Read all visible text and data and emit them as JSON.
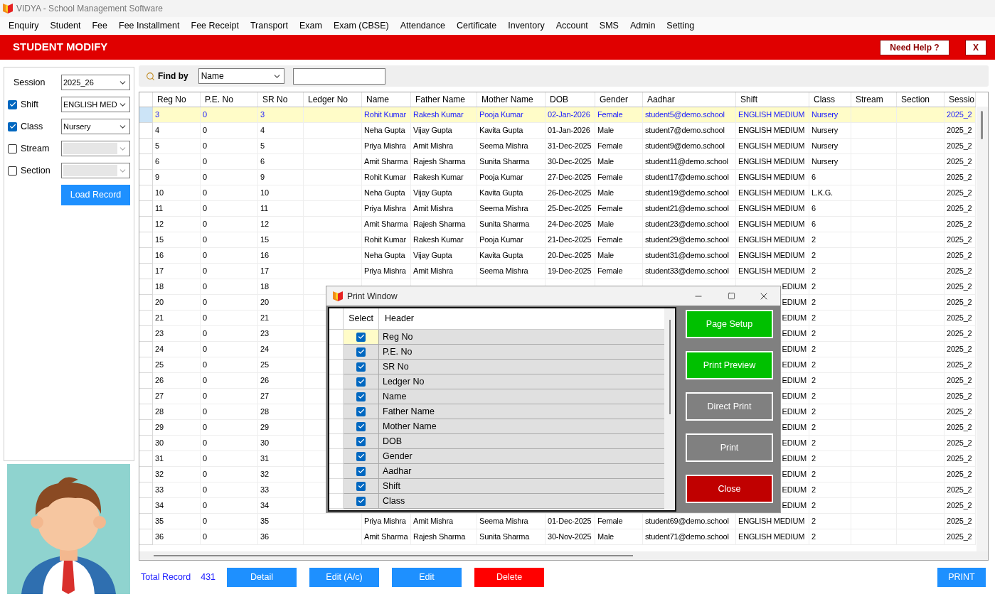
{
  "window": {
    "title": "VIDYA - School Management Software"
  },
  "menu": [
    "Enquiry",
    "Student",
    "Fee",
    "Fee Installment",
    "Fee Receipt",
    "Transport",
    "Exam",
    "Exam (CBSE)",
    "Attendance",
    "Certificate",
    "Inventory",
    "Account",
    "SMS",
    "Admin",
    "Setting"
  ],
  "header": {
    "title": "STUDENT MODIFY",
    "help_button": "Need Help ?",
    "close_button": "X"
  },
  "filters": [
    {
      "kind": "plain",
      "label": "Session",
      "value": "2025_26",
      "disabled": false
    },
    {
      "kind": "checkbox",
      "label": "Shift",
      "checked": true,
      "value": "ENGLISH MED",
      "disabled": false
    },
    {
      "kind": "checkbox",
      "label": "Class",
      "checked": true,
      "value": "Nursery",
      "disabled": false
    },
    {
      "kind": "checkbox",
      "label": "Stream",
      "checked": false,
      "disabled": true
    },
    {
      "kind": "checkbox",
      "label": "Section",
      "checked": false,
      "disabled": true
    }
  ],
  "load_button": "Load Record",
  "find": {
    "label": "Find by",
    "field": "Name"
  },
  "table": {
    "columns": [
      "Reg No",
      "P.E. No",
      "SR No",
      "Ledger No",
      "Name",
      "Father Name",
      "Mother Name",
      "DOB",
      "Gender",
      "Aadhar",
      "Shift",
      "Class",
      "Stream",
      "Section",
      "Sessio"
    ],
    "rows": [
      {
        "kind": "full",
        "selected": true,
        "reg_no": "3",
        "pe_no": "0",
        "sr_no": "3",
        "name": "Rohit Kumar",
        "father_name": "Rakesh Kumar",
        "mother_name": "Pooja Kumar",
        "dob": "02-Jan-2026",
        "gender": "Female",
        "aadhar": "student5@demo.school",
        "shift": "ENGLISH MEDIUM",
        "class": "Nursery",
        "session": "2025_2"
      },
      {
        "kind": "full",
        "selected": false,
        "reg_no": "4",
        "pe_no": "0",
        "sr_no": "4",
        "name": "Neha Gupta",
        "father_name": "Vijay Gupta",
        "mother_name": "Kavita Gupta",
        "dob": "01-Jan-2026",
        "gender": "Male",
        "aadhar": "student7@demo.school",
        "shift": "ENGLISH MEDIUM",
        "class": "Nursery",
        "session": "2025_2"
      },
      {
        "kind": "full",
        "selected": false,
        "reg_no": "5",
        "pe_no": "0",
        "sr_no": "5",
        "name": "Priya Mishra",
        "father_name": "Amit Mishra",
        "mother_name": "Seema Mishra",
        "dob": "31-Dec-2025",
        "gender": "Female",
        "aadhar": "student9@demo.school",
        "shift": "ENGLISH MEDIUM",
        "class": "Nursery",
        "session": "2025_2"
      },
      {
        "kind": "full",
        "selected": false,
        "reg_no": "6",
        "pe_no": "0",
        "sr_no": "6",
        "name": "Amit Sharma",
        "father_name": "Rajesh Sharma",
        "mother_name": "Sunita Sharma",
        "dob": "30-Dec-2025",
        "gender": "Male",
        "aadhar": "student11@demo.school",
        "shift": "ENGLISH MEDIUM",
        "class": "Nursery",
        "session": "2025_2"
      },
      {
        "kind": "full",
        "selected": false,
        "reg_no": "9",
        "pe_no": "0",
        "sr_no": "9",
        "name": "Rohit Kumar",
        "father_name": "Rakesh Kumar",
        "mother_name": "Pooja Kumar",
        "dob": "27-Dec-2025",
        "gender": "Female",
        "aadhar": "student17@demo.school",
        "shift": "ENGLISH MEDIUM",
        "class": "6",
        "session": "2025_2"
      },
      {
        "kind": "full",
        "selected": false,
        "reg_no": "10",
        "pe_no": "0",
        "sr_no": "10",
        "name": "Neha Gupta",
        "father_name": "Vijay Gupta",
        "mother_name": "Kavita Gupta",
        "dob": "26-Dec-2025",
        "gender": "Male",
        "aadhar": "student19@demo.school",
        "shift": "ENGLISH MEDIUM",
        "class": "L.K.G.",
        "session": "2025_2"
      },
      {
        "kind": "full",
        "selected": false,
        "reg_no": "11",
        "pe_no": "0",
        "sr_no": "11",
        "name": "Priya Mishra",
        "father_name": "Amit Mishra",
        "mother_name": "Seema Mishra",
        "dob": "25-Dec-2025",
        "gender": "Female",
        "aadhar": "student21@demo.school",
        "shift": "ENGLISH MEDIUM",
        "class": "6",
        "session": "2025_2"
      },
      {
        "kind": "full",
        "selected": false,
        "reg_no": "12",
        "pe_no": "0",
        "sr_no": "12",
        "name": "Amit Sharma",
        "father_name": "Rajesh Sharma",
        "mother_name": "Sunita Sharma",
        "dob": "24-Dec-2025",
        "gender": "Male",
        "aadhar": "student23@demo.school",
        "shift": "ENGLISH MEDIUM",
        "class": "6",
        "session": "2025_2"
      },
      {
        "kind": "full",
        "selected": false,
        "reg_no": "15",
        "pe_no": "0",
        "sr_no": "15",
        "name": "Rohit Kumar",
        "father_name": "Rakesh Kumar",
        "mother_name": "Pooja Kumar",
        "dob": "21-Dec-2025",
        "gender": "Female",
        "aadhar": "student29@demo.school",
        "shift": "ENGLISH MEDIUM",
        "class": "2",
        "session": "2025_2"
      },
      {
        "kind": "full",
        "selected": false,
        "reg_no": "16",
        "pe_no": "0",
        "sr_no": "16",
        "name": "Neha Gupta",
        "father_name": "Vijay Gupta",
        "mother_name": "Kavita Gupta",
        "dob": "20-Dec-2025",
        "gender": "Male",
        "aadhar": "student31@demo.school",
        "shift": "ENGLISH MEDIUM",
        "class": "2",
        "session": "2025_2"
      },
      {
        "kind": "full",
        "selected": false,
        "reg_no": "17",
        "pe_no": "0",
        "sr_no": "17",
        "name": "Priya Mishra",
        "father_name": "Amit Mishra",
        "mother_name": "Seema Mishra",
        "dob": "19-Dec-2025",
        "gender": "Female",
        "aadhar": "student33@demo.school",
        "shift": "ENGLISH MEDIUM",
        "class": "2",
        "session": "2025_2"
      },
      {
        "kind": "behind-dialog",
        "selected": false,
        "reg_no": "18",
        "pe_no": "0",
        "sr_no": "18",
        "shift": "EDIUM",
        "class": "2",
        "session": "2025_2"
      },
      {
        "kind": "behind-dialog",
        "selected": false,
        "reg_no": "20",
        "pe_no": "0",
        "sr_no": "20",
        "shift": "EDIUM",
        "class": "2",
        "session": "2025_2"
      },
      {
        "kind": "behind-dialog",
        "selected": false,
        "reg_no": "21",
        "pe_no": "0",
        "sr_no": "21",
        "shift": "EDIUM",
        "class": "2",
        "session": "2025_2"
      },
      {
        "kind": "behind-dialog",
        "selected": false,
        "reg_no": "23",
        "pe_no": "0",
        "sr_no": "23",
        "shift": "EDIUM",
        "class": "2",
        "session": "2025_2"
      },
      {
        "kind": "behind-dialog",
        "selected": false,
        "reg_no": "24",
        "pe_no": "0",
        "sr_no": "24",
        "shift": "EDIUM",
        "class": "2",
        "session": "2025_2"
      },
      {
        "kind": "behind-dialog",
        "selected": false,
        "reg_no": "25",
        "pe_no": "0",
        "sr_no": "25",
        "shift": "EDIUM",
        "class": "2",
        "session": "2025_2"
      },
      {
        "kind": "behind-dialog",
        "selected": false,
        "reg_no": "26",
        "pe_no": "0",
        "sr_no": "26",
        "shift": "EDIUM",
        "class": "2",
        "session": "2025_2"
      },
      {
        "kind": "behind-dialog",
        "selected": false,
        "reg_no": "27",
        "pe_no": "0",
        "sr_no": "27",
        "shift": "EDIUM",
        "class": "2",
        "session": "2025_2"
      },
      {
        "kind": "behind-dialog",
        "selected": false,
        "reg_no": "28",
        "pe_no": "0",
        "sr_no": "28",
        "shift": "EDIUM",
        "class": "2",
        "session": "2025_2"
      },
      {
        "kind": "behind-dialog",
        "selected": false,
        "reg_no": "29",
        "pe_no": "0",
        "sr_no": "29",
        "shift": "EDIUM",
        "class": "2",
        "session": "2025_2"
      },
      {
        "kind": "behind-dialog",
        "selected": false,
        "reg_no": "30",
        "pe_no": "0",
        "sr_no": "30",
        "shift": "EDIUM",
        "class": "2",
        "session": "2025_2"
      },
      {
        "kind": "behind-dialog",
        "selected": false,
        "reg_no": "31",
        "pe_no": "0",
        "sr_no": "31",
        "shift": "EDIUM",
        "class": "2",
        "session": "2025_2"
      },
      {
        "kind": "behind-dialog",
        "selected": false,
        "reg_no": "32",
        "pe_no": "0",
        "sr_no": "32",
        "shift": "EDIUM",
        "class": "2",
        "session": "2025_2"
      },
      {
        "kind": "behind-dialog",
        "selected": false,
        "reg_no": "33",
        "pe_no": "0",
        "sr_no": "33",
        "shift": "EDIUM",
        "class": "2",
        "session": "2025_2"
      },
      {
        "kind": "behind-dialog",
        "selected": false,
        "reg_no": "34",
        "pe_no": "0",
        "sr_no": "34",
        "shift": "EDIUM",
        "class": "2",
        "session": "2025_2"
      },
      {
        "kind": "full",
        "selected": false,
        "reg_no": "35",
        "pe_no": "0",
        "sr_no": "35",
        "name": "Priya Mishra",
        "father_name": "Amit Mishra",
        "mother_name": "Seema Mishra",
        "dob": "01-Dec-2025",
        "gender": "Female",
        "aadhar": "student69@demo.school",
        "shift": "ENGLISH MEDIUM",
        "class": "2",
        "session": "2025_2"
      },
      {
        "kind": "full",
        "selected": false,
        "reg_no": "36",
        "pe_no": "0",
        "sr_no": "36",
        "name": "Amit Sharma",
        "father_name": "Rajesh Sharma",
        "mother_name": "Sunita Sharma",
        "dob": "30-Nov-2025",
        "gender": "Male",
        "aadhar": "student71@demo.school",
        "shift": "ENGLISH MEDIUM",
        "class": "2",
        "session": "2025_2"
      }
    ]
  },
  "footer": {
    "total_label": "Total Record",
    "total": "431",
    "buttons": [
      {
        "label": "Detail",
        "kind": "primary"
      },
      {
        "label": "Edit (A/c)",
        "kind": "primary"
      },
      {
        "label": "Edit",
        "kind": "primary"
      },
      {
        "label": "Delete",
        "kind": "danger"
      }
    ],
    "print_button": "PRINT"
  },
  "print_window": {
    "title": "Print Window",
    "columns": [
      "Select",
      "Header"
    ],
    "rows": [
      {
        "header": "Reg No",
        "checked": true,
        "selected": true
      },
      {
        "header": "P.E. No",
        "checked": true,
        "selected": false
      },
      {
        "header": "SR No",
        "checked": true,
        "selected": false
      },
      {
        "header": "Ledger No",
        "checked": true,
        "selected": false
      },
      {
        "header": "Name",
        "checked": true,
        "selected": false
      },
      {
        "header": "Father Name",
        "checked": true,
        "selected": false
      },
      {
        "header": "Mother Name",
        "checked": true,
        "selected": false
      },
      {
        "header": "DOB",
        "checked": true,
        "selected": false
      },
      {
        "header": "Gender",
        "checked": true,
        "selected": false
      },
      {
        "header": "Aadhar",
        "checked": true,
        "selected": false
      },
      {
        "header": "Shift",
        "checked": true,
        "selected": false
      },
      {
        "header": "Class",
        "checked": true,
        "selected": false
      }
    ],
    "buttons": [
      {
        "label": "Page Setup",
        "kind": "green"
      },
      {
        "label": "Print Preview",
        "kind": "green"
      },
      {
        "label": "Direct Print",
        "kind": "gray"
      },
      {
        "label": "Print",
        "kind": "gray"
      },
      {
        "label": "Close",
        "kind": "red"
      }
    ]
  }
}
